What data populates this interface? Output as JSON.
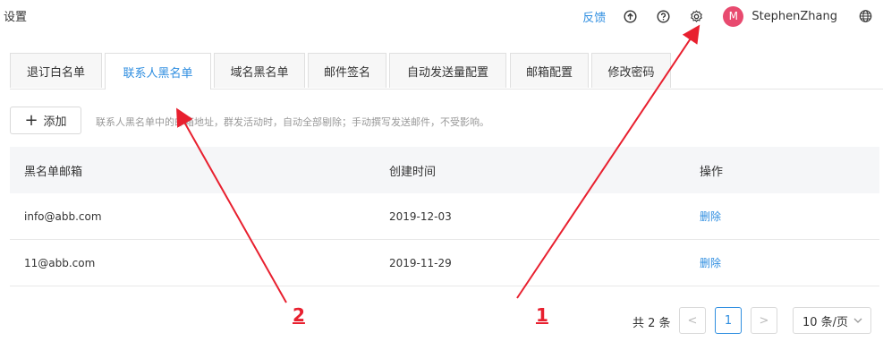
{
  "header": {
    "title": "设置",
    "feedback": "反馈",
    "user": {
      "initial": "M",
      "name": "StephenZhang"
    },
    "icons": [
      "upload-icon",
      "help-icon",
      "gear-icon",
      "globe-icon"
    ]
  },
  "tabs": [
    {
      "label": "退订白名单"
    },
    {
      "label": "联系人黑名单",
      "active": true
    },
    {
      "label": "域名黑名单"
    },
    {
      "label": "邮件签名"
    },
    {
      "label": "自动发送量配置"
    },
    {
      "label": "邮箱配置"
    },
    {
      "label": "修改密码"
    }
  ],
  "toolbar": {
    "add_label": "添加",
    "hint": "联系人黑名单中的邮箱地址，群发活动时，自动全部剔除；手动撰写发送邮件，不受影响。"
  },
  "table": {
    "columns": [
      "黑名单邮箱",
      "创建时间",
      "操作"
    ],
    "rows": [
      {
        "email": "info@abb.com",
        "date": "2019-12-03",
        "action": "删除"
      },
      {
        "email": "11@abb.com",
        "date": "2019-11-29",
        "action": "删除"
      }
    ]
  },
  "pagination": {
    "total": "共 2 条",
    "prev": "<",
    "current": "1",
    "next": ">",
    "page_size": "10 条/页"
  },
  "annotations": {
    "label_1": "1",
    "label_2": "2",
    "color": "#e8202f"
  },
  "colors": {
    "accent": "#2f8ee0",
    "avatar": "#e84a6f"
  }
}
